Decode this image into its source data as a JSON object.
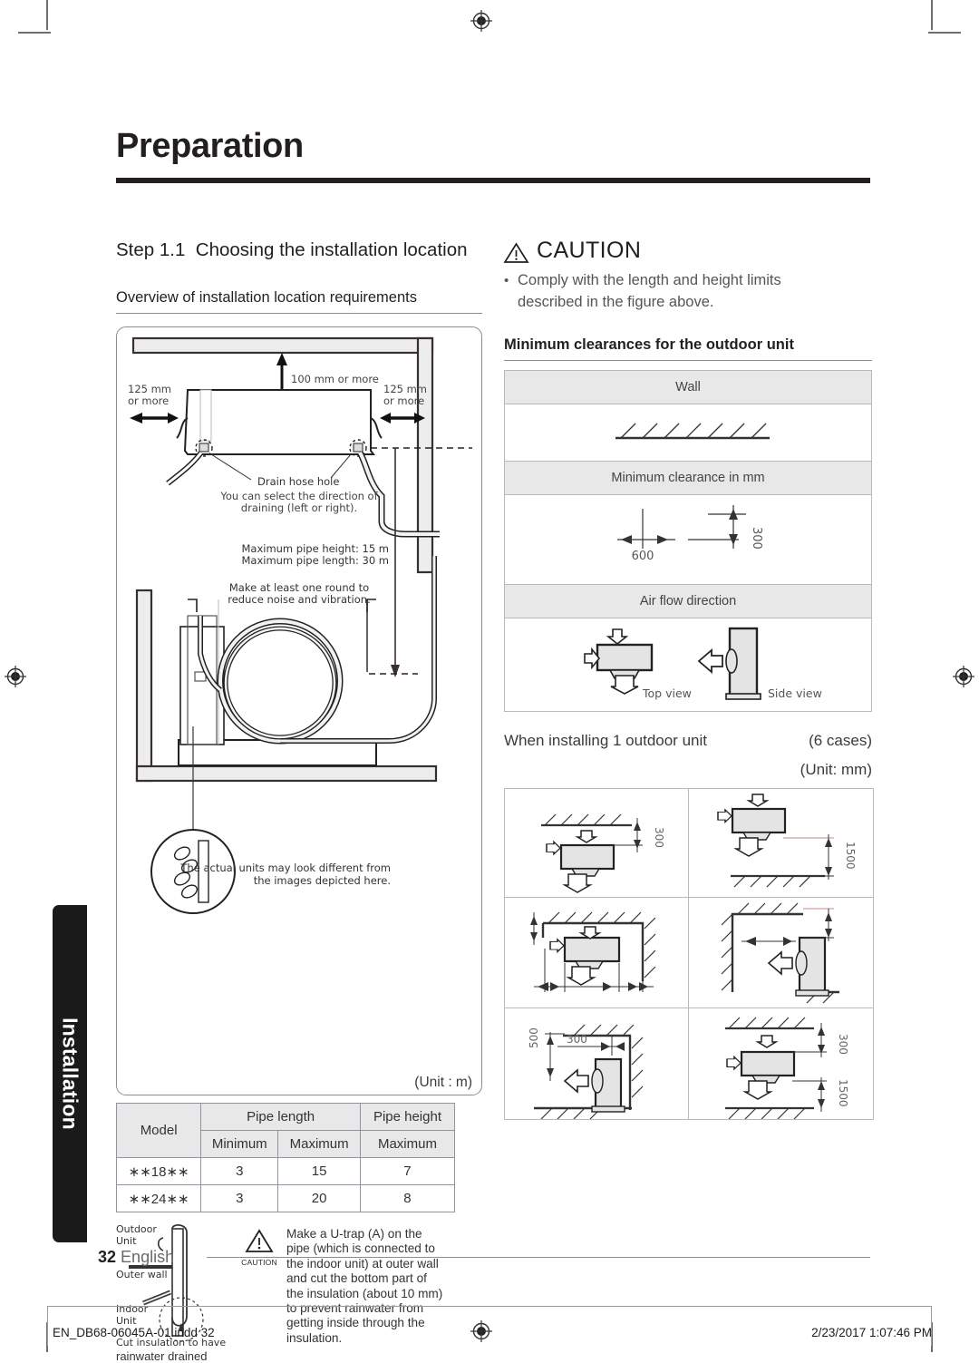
{
  "page": {
    "chapter_title": "Preparation",
    "side_tab": "Installation",
    "page_number": "32",
    "language": "English"
  },
  "left": {
    "step_heading": "Step 1.1  Choosing the installation location",
    "step_number": "Step 1.1",
    "step_text": "Choosing the installation location",
    "overview_heading": "Overview of installation location requirements",
    "figure": {
      "clearance_top": "100 mm or more",
      "clearance_left_l1": "125 mm",
      "clearance_left_l2": "or more",
      "clearance_right_l1": "125 mm",
      "clearance_right_l2": "or more",
      "drain_hose_hole": "Drain hose hole",
      "drain_note_l1": "You can select the direction of",
      "drain_note_l2": "draining (left or right).",
      "max_pipe_height": "Maximum pipe height: 15 m",
      "max_pipe_length": "Maximum pipe length: 30 m",
      "round_note_l1": "Make at least one round to",
      "round_note_l2": "reduce noise and vibration.",
      "actual_note_l1": "The actual units may look different from",
      "actual_note_l2": "the images depicted here."
    },
    "unit_label": "(Unit : m)",
    "pipe_table": {
      "col_model": "Model",
      "col_pipe_length": "Pipe length",
      "col_pipe_height": "Pipe height",
      "sub_minimum": "Minimum",
      "sub_maximum": "Maximum",
      "sub_maximum2": "Maximum",
      "rows": [
        {
          "model": "∗∗18∗∗",
          "len_min": "3",
          "len_max": "15",
          "height_max": "7"
        },
        {
          "model": "∗∗24∗∗",
          "len_min": "3",
          "len_max": "20",
          "height_max": "8"
        }
      ]
    },
    "utrap": {
      "label_outdoor_l1": "Outdoor",
      "label_outdoor_l2": "Unit",
      "label_outer_wall": "Outer wall",
      "label_indoor_l1": "Indoor",
      "label_indoor_l2": "Unit",
      "caption_l1": "Cut insulation to have",
      "caption_l2": "rainwater drained",
      "caution_word": "CAUTION",
      "text_lines": [
        "Make a U-trap (A) on the",
        "pipe (which is connected to",
        "the indoor unit) at outer wall",
        "and cut the bottom part of",
        "the insulation (about 10 mm)",
        "to prevent rainwater from",
        "getting inside through the",
        "insulation."
      ]
    }
  },
  "right": {
    "caution_word": "CAUTION",
    "caution_bullet": "•",
    "caution_text_l1": "Comply with the length and height limits",
    "caution_text_l2": "described in the figure above.",
    "min_clearance_heading": "Minimum clearances for the outdoor unit",
    "clearance_table": {
      "row_wall": "Wall",
      "row_min_clearance": "Minimum clearance in mm",
      "row_air_flow": "Air flow direction",
      "dim_600": "600",
      "dim_300": "300",
      "top_view": "Top view",
      "side_view": "Side view"
    },
    "one_unit_heading": "When installing 1 outdoor unit",
    "cases_label": "(6 cases)",
    "unit_label": "(Unit: mm)",
    "cases": [
      {
        "id": "case-1",
        "dims": [
          "300"
        ]
      },
      {
        "id": "case-2",
        "dims": [
          "1500"
        ]
      },
      {
        "id": "case-3",
        "dims": []
      },
      {
        "id": "case-4",
        "dims": []
      },
      {
        "id": "case-5",
        "dims": [
          "500",
          "300"
        ]
      },
      {
        "id": "case-6",
        "dims": [
          "300",
          "1500"
        ]
      }
    ]
  },
  "footer": {
    "file_name": "EN_DB68-06045A-01.indd   32",
    "timestamp": "2/23/2017   1:07:46 PM"
  },
  "colors": {
    "ink": "#231f20",
    "header_fill": "#e8e8e8",
    "rule": "#8d8d8d",
    "body_text": "#555555"
  }
}
